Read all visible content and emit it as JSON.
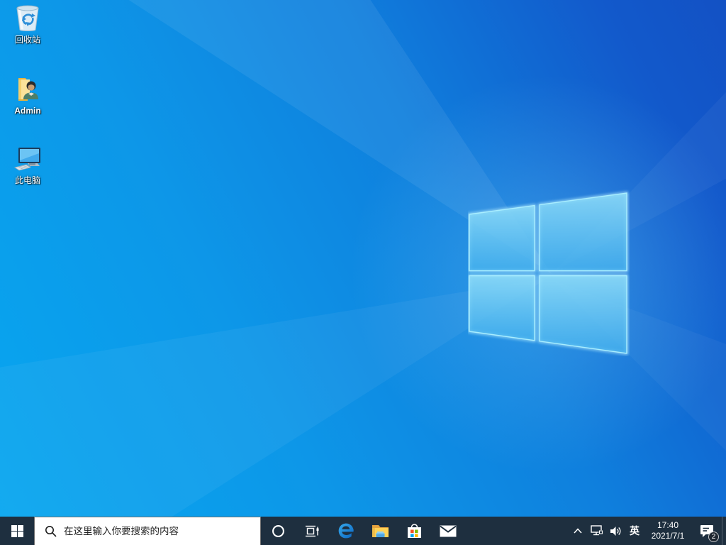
{
  "wallpaper": {
    "description": "windows-10-light-rays",
    "base_colors": [
      "#07a7f0",
      "#0d97e8",
      "#1259cb",
      "#1351c4"
    ],
    "logo_pane_fill": "#58bff1",
    "logo_edge_glow": "#a9eeff"
  },
  "desktop": {
    "icons": [
      {
        "name": "recycle-bin",
        "label": "回收站"
      },
      {
        "name": "user-folder-admin",
        "label": "Admin"
      },
      {
        "name": "this-pc",
        "label": "此电脑"
      }
    ]
  },
  "taskbar": {
    "background": "#1e2f3f",
    "start": {
      "icon": "windows-start-logo"
    },
    "search": {
      "icon": "search-icon",
      "placeholder": "在这里输入你要搜索的内容"
    },
    "apps": [
      {
        "name": "cortana"
      },
      {
        "name": "task-view"
      },
      {
        "name": "edge-browser"
      },
      {
        "name": "file-explorer"
      },
      {
        "name": "microsoft-store"
      },
      {
        "name": "mail"
      }
    ],
    "tray": {
      "hidden_icons_icon": "chevron-up",
      "network_icon": "wired-network",
      "volume_icon": "speaker-volume",
      "ime_language": "英",
      "clock": {
        "time": "17:40",
        "date": "2021/7/1"
      },
      "action_center": {
        "icon": "notification-bubble",
        "badge_count": "2"
      }
    }
  }
}
